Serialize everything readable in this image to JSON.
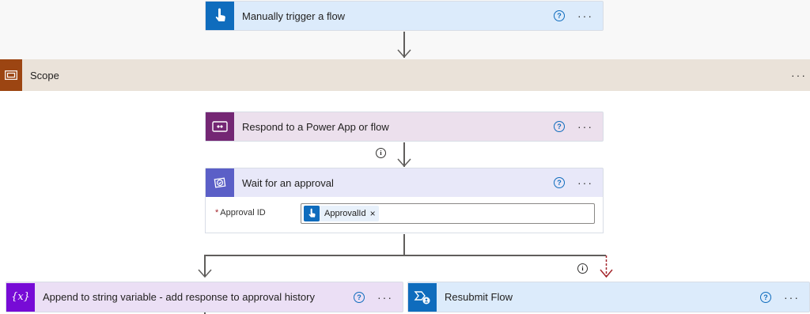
{
  "trigger": {
    "title": "Manually trigger a flow",
    "icon": "touch-hand-icon",
    "color": "#0f6cbd"
  },
  "scope": {
    "title": "Scope",
    "icon": "scope-icon",
    "color": "#9c4512"
  },
  "respond": {
    "title": "Respond to a Power App or flow",
    "icon": "power-apps-icon",
    "color": "#742774"
  },
  "wait": {
    "title": "Wait for an approval",
    "icon": "approvals-icon",
    "color": "#5b5fc7",
    "field_label": "Approval ID",
    "required_mark": "*",
    "token_label": "ApprovalId",
    "token_remove": "×"
  },
  "append": {
    "title": "Append to string variable - add response to approval history",
    "icon": "variable-icon",
    "icon_text": "{x}",
    "color": "#770bd6"
  },
  "resubmit": {
    "title": "Resubmit Flow",
    "icon": "flow-icon",
    "color": "#0f6cbd"
  },
  "common": {
    "help": "?",
    "more": "···",
    "info": "i"
  }
}
